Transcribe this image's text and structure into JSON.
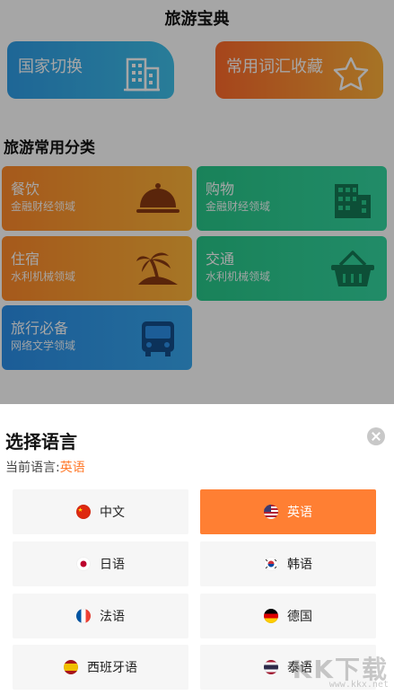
{
  "header": {
    "title": "旅游宝典"
  },
  "top_cards": [
    {
      "label": "国家切换",
      "icon": "building-icon",
      "color": "#2f9de6"
    },
    {
      "label": "常用词汇收藏",
      "icon": "star-icon",
      "color": "#ff7a2b"
    }
  ],
  "section": {
    "title": "旅游常用分类"
  },
  "categories": [
    {
      "title": "餐饮",
      "subtitle": "金融财经领域",
      "icon": "cloche-icon",
      "color": "orange"
    },
    {
      "title": "购物",
      "subtitle": "金融财经领域",
      "icon": "buildings-icon",
      "color": "green"
    },
    {
      "title": "住宿",
      "subtitle": "水利机械领域",
      "icon": "palm-island-icon",
      "color": "orange"
    },
    {
      "title": "交通",
      "subtitle": "水利机械领域",
      "icon": "basket-icon",
      "color": "green"
    },
    {
      "title": "旅行必备",
      "subtitle": "网络文学领域",
      "icon": "bus-icon",
      "color": "blue"
    }
  ],
  "sheet": {
    "title": "选择语言",
    "current_label": "当前语言:",
    "current_value": "英语",
    "languages": [
      {
        "label": "中文",
        "flag": "china-flag-icon",
        "selected": false
      },
      {
        "label": "英语",
        "flag": "usa-flag-icon",
        "selected": true
      },
      {
        "label": "日语",
        "flag": "japan-flag-icon",
        "selected": false
      },
      {
        "label": "韩语",
        "flag": "korea-flag-icon",
        "selected": false
      },
      {
        "label": "法语",
        "flag": "france-flag-icon",
        "selected": false
      },
      {
        "label": "德国",
        "flag": "germany-flag-icon",
        "selected": false
      },
      {
        "label": "西班牙语",
        "flag": "spain-flag-icon",
        "selected": false
      },
      {
        "label": "泰语",
        "flag": "thailand-flag-icon",
        "selected": false
      }
    ]
  },
  "watermark": {
    "text": "KK下载",
    "url": "www.kkx.net"
  },
  "colors": {
    "accent": "#ff7f33",
    "blue": "#2f9de6",
    "green": "#27c88a",
    "orange": "#ff8a2a"
  }
}
